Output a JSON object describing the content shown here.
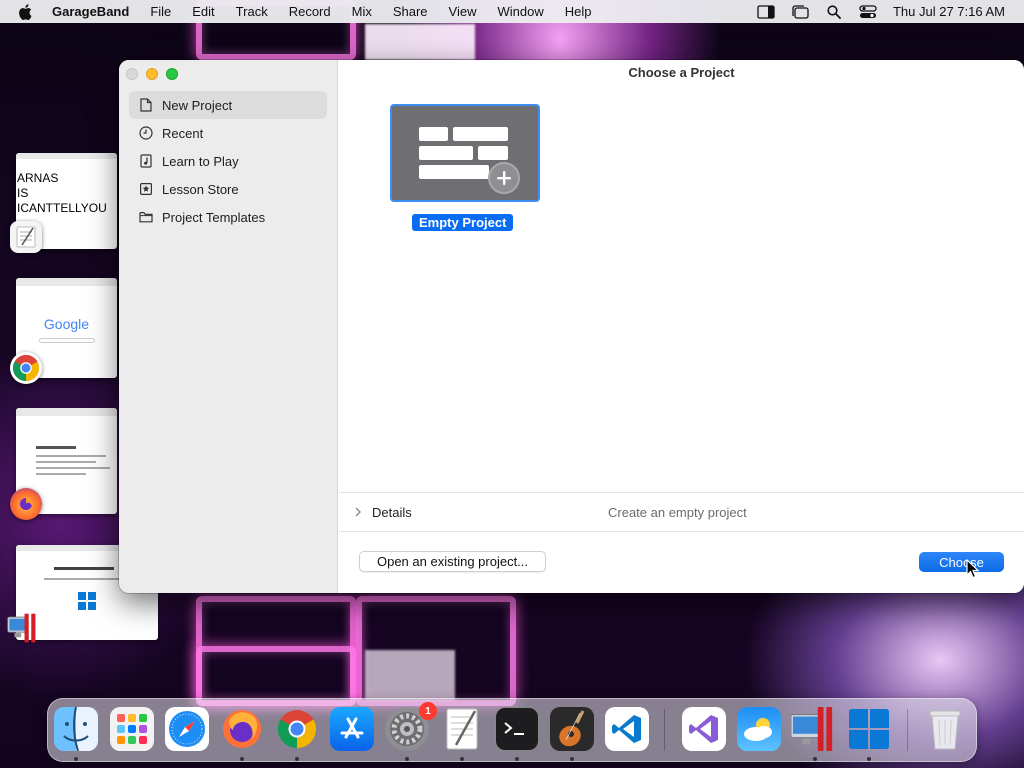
{
  "menubar": {
    "apple_icon": "apple-icon",
    "app_name": "GarageBand",
    "items": [
      "File",
      "Edit",
      "Track",
      "Record",
      "Mix",
      "Share",
      "View",
      "Window",
      "Help"
    ],
    "status_icons": [
      "sidebar-icon",
      "stage-manager-icon",
      "search-icon",
      "control-center-icon"
    ],
    "clock": "Thu Jul 27  7:16 AM"
  },
  "stage_manager": {
    "thumbnails": [
      {
        "app": "TextEdit",
        "text_lines": [
          "ARNAS",
          "IS",
          "ICANTTELLYOU"
        ]
      },
      {
        "app": "Google Chrome",
        "logo_text": "Google"
      },
      {
        "app": "Firefox"
      },
      {
        "app": "Windows App"
      }
    ]
  },
  "window": {
    "title": "Choose a Project",
    "sidebar": {
      "items": [
        {
          "label": "New Project",
          "icon": "document-icon",
          "selected": true
        },
        {
          "label": "Recent",
          "icon": "clock-icon",
          "selected": false
        },
        {
          "label": "Learn to Play",
          "icon": "music-note-icon",
          "selected": false
        },
        {
          "label": "Lesson Store",
          "icon": "star-icon",
          "selected": false
        },
        {
          "label": "Project Templates",
          "icon": "folder-icon",
          "selected": false
        }
      ]
    },
    "project": {
      "label": "Empty Project",
      "selected": true
    },
    "details": {
      "label": "Details",
      "description": "Create an empty project"
    },
    "buttons": {
      "open_existing": "Open an existing project...",
      "choose": "Choose"
    }
  },
  "dock": {
    "apps": [
      {
        "name": "Finder",
        "icon": "finder-icon",
        "running": true
      },
      {
        "name": "Launchpad",
        "icon": "launchpad-icon",
        "running": false
      },
      {
        "name": "Safari",
        "icon": "safari-icon",
        "running": false
      },
      {
        "name": "Firefox",
        "icon": "firefox-icon",
        "running": true
      },
      {
        "name": "Google Chrome",
        "icon": "chrome-icon",
        "running": true
      },
      {
        "name": "App Store",
        "icon": "app-store-icon",
        "running": false
      },
      {
        "name": "System Settings",
        "icon": "gear-icon",
        "running": true,
        "badge": "1"
      },
      {
        "name": "TextEdit",
        "icon": "textedit-icon",
        "running": true
      },
      {
        "name": "Terminal",
        "icon": "terminal-icon",
        "running": true
      },
      {
        "name": "GarageBand",
        "icon": "guitar-icon",
        "running": true
      },
      {
        "name": "Visual Studio Code",
        "icon": "vscode-icon",
        "running": false
      },
      {
        "name": "Visual Studio",
        "icon": "visual-studio-icon",
        "running": false
      },
      {
        "name": "Weather",
        "icon": "weather-icon",
        "running": false
      },
      {
        "name": "Parallels Desktop",
        "icon": "parallels-icon",
        "running": true
      },
      {
        "name": "Windows",
        "icon": "windows-icon",
        "running": true
      },
      {
        "name": "Trash",
        "icon": "trash-icon",
        "running": false
      }
    ]
  },
  "colors": {
    "accent": "#0a6cf0",
    "sidebar_bg": "#ececec",
    "badge": "#ff3b30"
  }
}
